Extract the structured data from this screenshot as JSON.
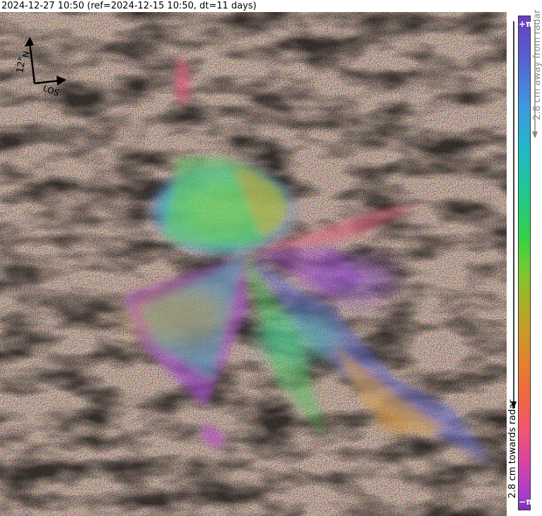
{
  "header": {
    "title": "2024-12-27 10:50 (ref=2024-12-15 10:50, dt=11 days)"
  },
  "compass": {
    "north_label": "N",
    "scale_label": "12°",
    "los_label": "LOS"
  },
  "colorbar": {
    "top_label": "+π",
    "bottom_label": "−π",
    "away_label": "2.8 cm away from radar",
    "towards_label": "2.8 cm towards radar",
    "away_color": "#888888",
    "towards_color": "#000000"
  }
}
